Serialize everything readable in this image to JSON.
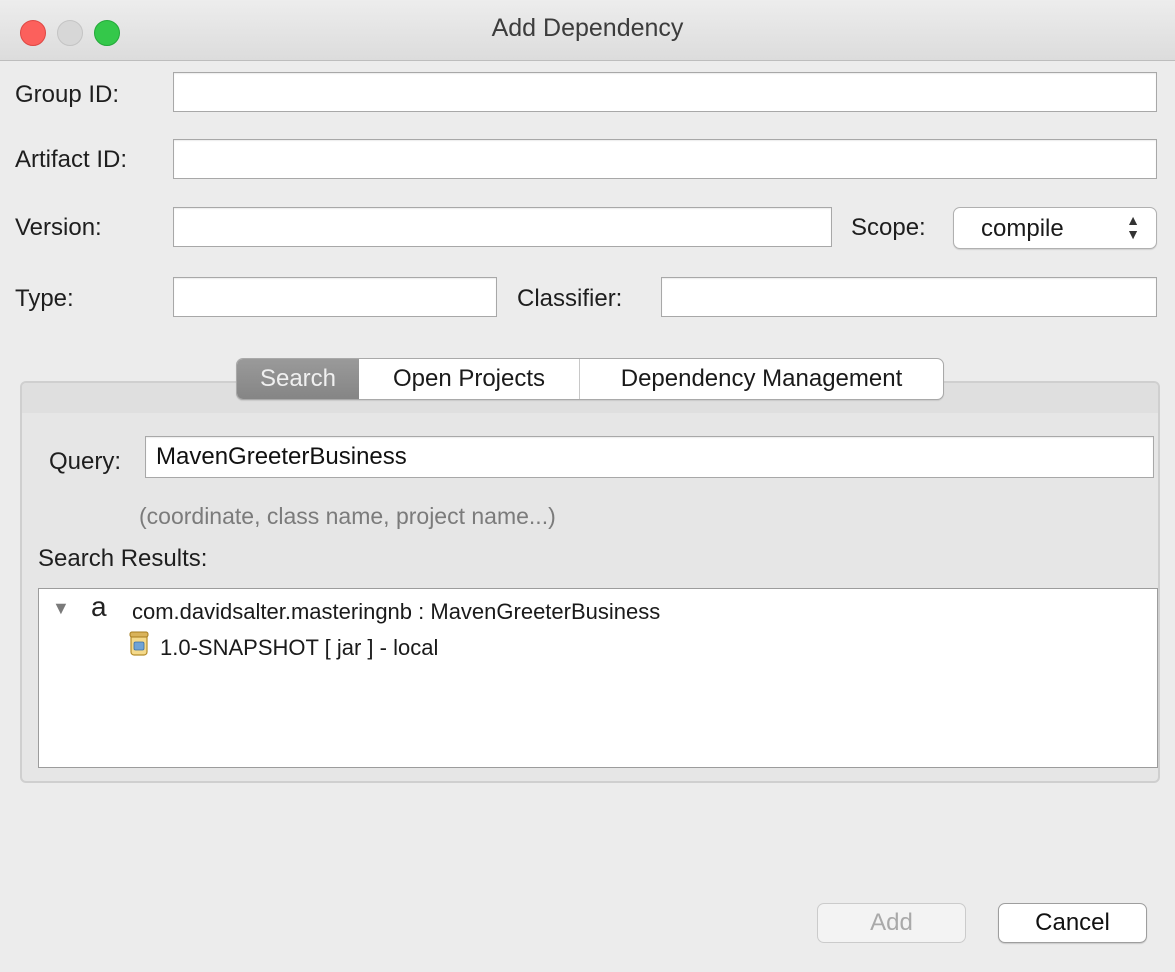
{
  "window": {
    "title": "Add Dependency"
  },
  "form": {
    "group_id": {
      "label": "Group ID:",
      "value": ""
    },
    "artifact_id": {
      "label": "Artifact ID:",
      "value": ""
    },
    "version": {
      "label": "Version:",
      "value": ""
    },
    "scope": {
      "label": "Scope:",
      "selected": "compile"
    },
    "type": {
      "label": "Type:",
      "value": ""
    },
    "classifier": {
      "label": "Classifier:",
      "value": ""
    }
  },
  "tabs": [
    {
      "label": "Search",
      "selected": true
    },
    {
      "label": "Open Projects",
      "selected": false
    },
    {
      "label": "Dependency Management",
      "selected": false
    }
  ],
  "search": {
    "query_label": "Query:",
    "query_value": "MavenGreeterBusiness",
    "hint": "(coordinate, class name, project name...)",
    "results_label": "Search Results:",
    "results": [
      {
        "artifact_glyph": "a",
        "label": "com.davidsalter.masteringnb : MavenGreeterBusiness",
        "expanded": true,
        "children": [
          {
            "label": "1.0-SNAPSHOT [ jar ]  - local",
            "icon": "jar-icon"
          }
        ]
      }
    ]
  },
  "buttons": {
    "add": "Add",
    "cancel": "Cancel"
  },
  "colors": {
    "close": "#fc605c",
    "maximize": "#34c84a",
    "tab_selected": "#8e8e8e"
  }
}
